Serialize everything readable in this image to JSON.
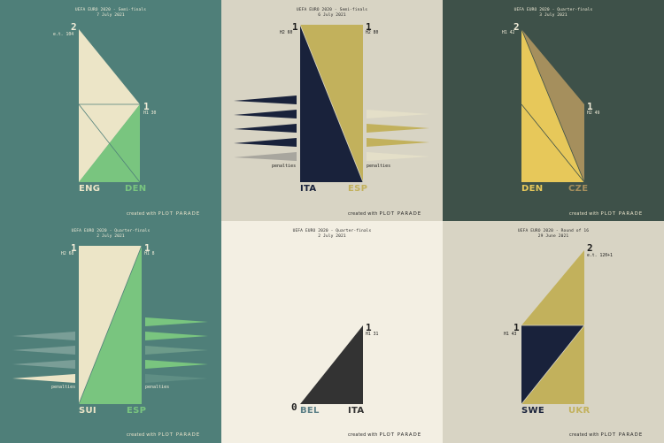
{
  "credit": {
    "prefix": "created with",
    "brand": "PLOT PARADE"
  },
  "penalties_label": "penalties",
  "panels": [
    {
      "id": "eng-den",
      "title": "UEFA EURO 2020 - Semi-finals",
      "date": "7 July 2021",
      "left": {
        "team": "ENG",
        "score": "2",
        "time": "e.t. 104"
      },
      "right": {
        "team": "DEN",
        "score": "1",
        "time": "H1 30"
      },
      "colors": {
        "bg": "#4f7f79",
        "left": "#ece5c7",
        "right": "#79c57f"
      }
    },
    {
      "id": "ita-esp",
      "title": "UEFA EURO 2020 - Semi-finals",
      "date": "6 July 2021",
      "left": {
        "team": "ITA",
        "score": "1",
        "time": "H2 60",
        "penalties": true
      },
      "right": {
        "team": "ESP",
        "score": "1",
        "time": "H2 80",
        "penalties": true
      },
      "colors": {
        "bg": "#d8d4c4",
        "left": "#19223b",
        "right": "#c2b15c"
      }
    },
    {
      "id": "den-cze",
      "title": "UEFA EURO 2020 - Quarter-finals",
      "date": "3 July 2021",
      "left": {
        "team": "DEN",
        "score": "2",
        "time": "H1 42"
      },
      "right": {
        "team": "CZE",
        "score": "1",
        "time": "H2 49"
      },
      "colors": {
        "bg": "#3e5149",
        "left": "#e7c85a",
        "right": "#a58f5d"
      }
    },
    {
      "id": "sui-esp",
      "title": "UEFA EURO 2020 - Quarter-finals",
      "date": "2 July 2021",
      "left": {
        "team": "SUI",
        "score": "1",
        "time": "H2 68",
        "penalties": true
      },
      "right": {
        "team": "ESP",
        "score": "1",
        "time": "H1 8",
        "penalties": true
      },
      "colors": {
        "bg": "#4f7f79",
        "left": "#ece5c7",
        "right": "#79c57f"
      }
    },
    {
      "id": "bel-ita",
      "title": "UEFA EURO 2020 - Quarter-finals",
      "date": "2 July 2021",
      "left": {
        "team": "BEL",
        "score": "0",
        "time": ""
      },
      "right": {
        "team": "ITA",
        "score": "1",
        "time": "H1 31"
      },
      "colors": {
        "bg": "#f3efe3",
        "left": "#5b7f86",
        "right": "#333333"
      }
    },
    {
      "id": "swe-ukr",
      "title": "UEFA EURO 2020 - Round of 16",
      "date": "29 June 2021",
      "left": {
        "team": "SWE",
        "score": "1",
        "time": "H1 43"
      },
      "right": {
        "team": "UKR",
        "score": "2",
        "time": "e.t. 120+1"
      },
      "colors": {
        "bg": "#d8d4c4",
        "left": "#19223b",
        "right": "#c2b15c"
      }
    }
  ]
}
